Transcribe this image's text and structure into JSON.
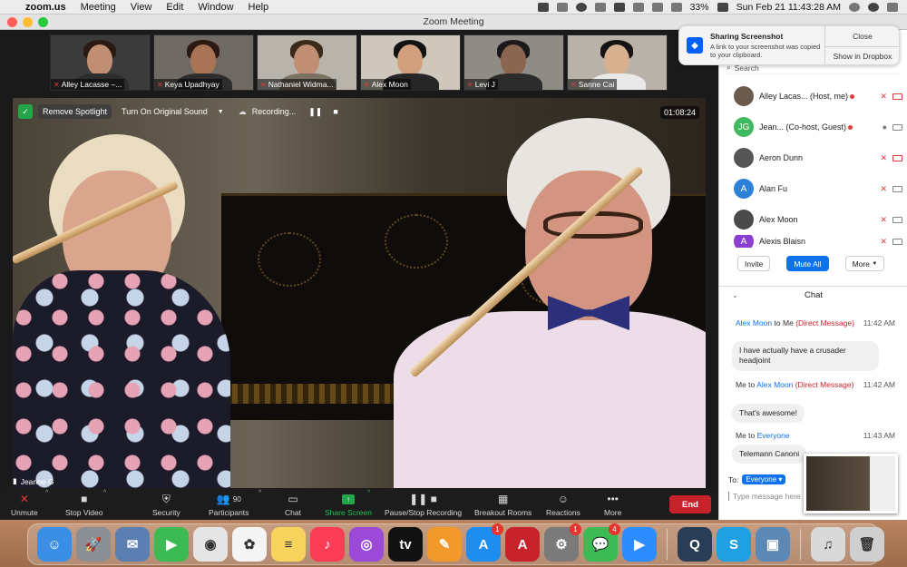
{
  "menubar": {
    "apple_icon": "apple-icon",
    "app_name": "zoom.us",
    "menus": [
      "Meeting",
      "View",
      "Edit",
      "Window",
      "Help"
    ],
    "battery": "33%",
    "datetime": "Sun Feb 21  11:43:28 AM"
  },
  "window": {
    "title": "Zoom Meeting"
  },
  "gallery": [
    {
      "name": "Alley Lacasse –..."
    },
    {
      "name": "Keya Upadhyay"
    },
    {
      "name": "Nathaniel Widma..."
    },
    {
      "name": "Alex Moon"
    },
    {
      "name": "Levi J"
    },
    {
      "name": "Sanne Cai"
    }
  ],
  "spotlight": {
    "remove_label": "Remove Spotlight",
    "original_sound_label": "Turn On Original Sound",
    "recording_label": "Recording...",
    "timer": "01:08:24",
    "speaker_name": "Jeanne G"
  },
  "toolbar": {
    "unmute": "Unmute",
    "stop_video": "Stop Video",
    "security": "Security",
    "participants": "Participants",
    "participants_count": "90",
    "chat": "Chat",
    "share_screen": "Share Screen",
    "pause_recording": "Pause/Stop Recording",
    "breakout_rooms": "Breakout Rooms",
    "reactions": "Reactions",
    "more": "More",
    "end": "End"
  },
  "notification": {
    "title": "Sharing Screenshot",
    "message": "A link to your screenshot was copied to your clipboard.",
    "close": "Close",
    "show_in_dropbox": "Show in Dropbox"
  },
  "panel": {
    "search_placeholder": "Search",
    "participants": [
      {
        "name": "Alley Lacas...  (Host, me)",
        "initials": "",
        "color": "#6b5a4e"
      },
      {
        "name": "Jean...  (Co-host, Guest)",
        "initials": "JG",
        "color": "#3fb95e"
      },
      {
        "name": "Aeron Dunn",
        "initials": "",
        "color": "#555555"
      },
      {
        "name": "Alan Fu",
        "initials": "A",
        "color": "#2d7fd8"
      },
      {
        "name": "Alex Moon",
        "initials": "",
        "color": "#4a4a4a"
      },
      {
        "name": "Alexis Blaisn",
        "initials": "A",
        "color": "#8a3fd0"
      }
    ],
    "invite": "Invite",
    "mute_all": "Mute All",
    "more": "More",
    "chat_title": "Chat",
    "messages": [
      {
        "sender": "Alex Moon",
        "to": "to Me",
        "type": "(Direct Message)",
        "time": "11:42 AM",
        "text": "I have actually have a crusader headjoint"
      },
      {
        "sender": "Me to",
        "to": "Alex Moon",
        "type": "(Direct Message)",
        "time": "11:42 AM",
        "text": "That's awesome!"
      },
      {
        "sender": "Me to",
        "to": "Everyone",
        "type": "",
        "time": "11:43 AM",
        "text": "Telemann Canoni"
      }
    ],
    "to_label": "To:",
    "to_value": "Everyone",
    "input_placeholder": "Type message here"
  },
  "dock": {
    "apps": [
      {
        "name": "finder-icon",
        "glyph": "☺",
        "color": "#3a8ee6",
        "badge": ""
      },
      {
        "name": "launchpad-icon",
        "glyph": "🚀",
        "color": "#8a8f96",
        "badge": ""
      },
      {
        "name": "preview-icon",
        "glyph": "✉",
        "color": "#5b7fb0",
        "badge": ""
      },
      {
        "name": "facetime-icon",
        "glyph": "▶",
        "color": "#3cba54",
        "badge": ""
      },
      {
        "name": "chrome-icon",
        "glyph": "◉",
        "color": "#e5e5e5",
        "badge": ""
      },
      {
        "name": "photos-icon",
        "glyph": "✿",
        "color": "#f4f4f4",
        "badge": ""
      },
      {
        "name": "notes-icon",
        "glyph": "≡",
        "color": "#f7d25c",
        "badge": ""
      },
      {
        "name": "music-icon",
        "glyph": "♪",
        "color": "#fa3c55",
        "badge": ""
      },
      {
        "name": "podcasts-icon",
        "glyph": "◎",
        "color": "#9a4ad6",
        "badge": ""
      },
      {
        "name": "tv-icon",
        "glyph": "tv",
        "color": "#111111",
        "badge": ""
      },
      {
        "name": "pages-icon",
        "glyph": "✎",
        "color": "#f19a2b",
        "badge": ""
      },
      {
        "name": "appstore-icon",
        "glyph": "A",
        "color": "#1e8df0",
        "badge": "1"
      },
      {
        "name": "acrobat-icon",
        "glyph": "A",
        "color": "#c8232c",
        "badge": ""
      },
      {
        "name": "system-preferences-icon",
        "glyph": "⚙",
        "color": "#7a7a7a",
        "badge": "1"
      },
      {
        "name": "messages-icon",
        "glyph": "💬",
        "color": "#3cba54",
        "badge": "4"
      },
      {
        "name": "zoom-icon",
        "glyph": "▶",
        "color": "#2d8cff",
        "badge": ""
      },
      {
        "name": "quicktime-icon",
        "glyph": "Q",
        "color": "#2a3d57",
        "badge": ""
      },
      {
        "name": "skype-icon",
        "glyph": "S",
        "color": "#1ea0e2",
        "badge": ""
      },
      {
        "name": "image-capture-icon",
        "glyph": "▣",
        "color": "#5b88b5",
        "badge": ""
      },
      {
        "name": "music-folder-icon",
        "glyph": "♫",
        "color": "#d9d9d9",
        "badge": ""
      },
      {
        "name": "trash-icon",
        "glyph": "🗑",
        "color": "#cfcfcf",
        "badge": ""
      }
    ]
  }
}
